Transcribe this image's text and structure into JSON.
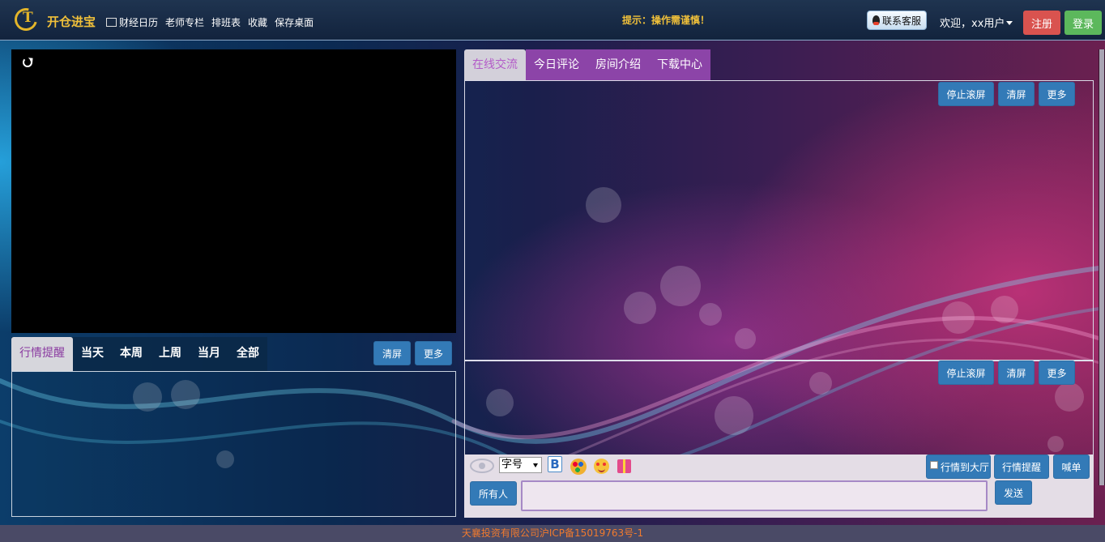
{
  "header": {
    "brand": "开仓进宝",
    "nav": [
      "财经日历",
      "老师专栏",
      "排班表",
      "收藏",
      "保存桌面"
    ],
    "notice": "提示：操作需谨慎！",
    "support_label": "联系客服",
    "welcome": "欢迎，xx用户",
    "register_label": "注册",
    "login_label": "登录"
  },
  "left_panel": {
    "tabs": [
      "行情提醒",
      "当天",
      "本周",
      "上周",
      "当月",
      "全部"
    ],
    "clear_label": "清屏",
    "more_label": "更多"
  },
  "right_panel": {
    "tabs": [
      "在线交流",
      "今日评论",
      "房间介绍",
      "下载中心"
    ],
    "stop_scroll_label": "停止滚屏",
    "clear_label": "清屏",
    "more_label": "更多"
  },
  "toolbar": {
    "font_size": "字号",
    "bold": "B",
    "to_hall_label": "行情到大厅",
    "market_alert_label": "行情提醒",
    "shout_label": "喊单",
    "recipient_label": "所有人",
    "send_label": "发送",
    "message_placeholder": ""
  },
  "footer": {
    "text": "天襄投资有限公司沪ICP备15019763号-1"
  },
  "colors": {
    "accent": "#337ab7",
    "register": "#d9534f",
    "login": "#5cb85c",
    "brand": "#f0c03a",
    "tab_purple": "#8c44a8"
  }
}
